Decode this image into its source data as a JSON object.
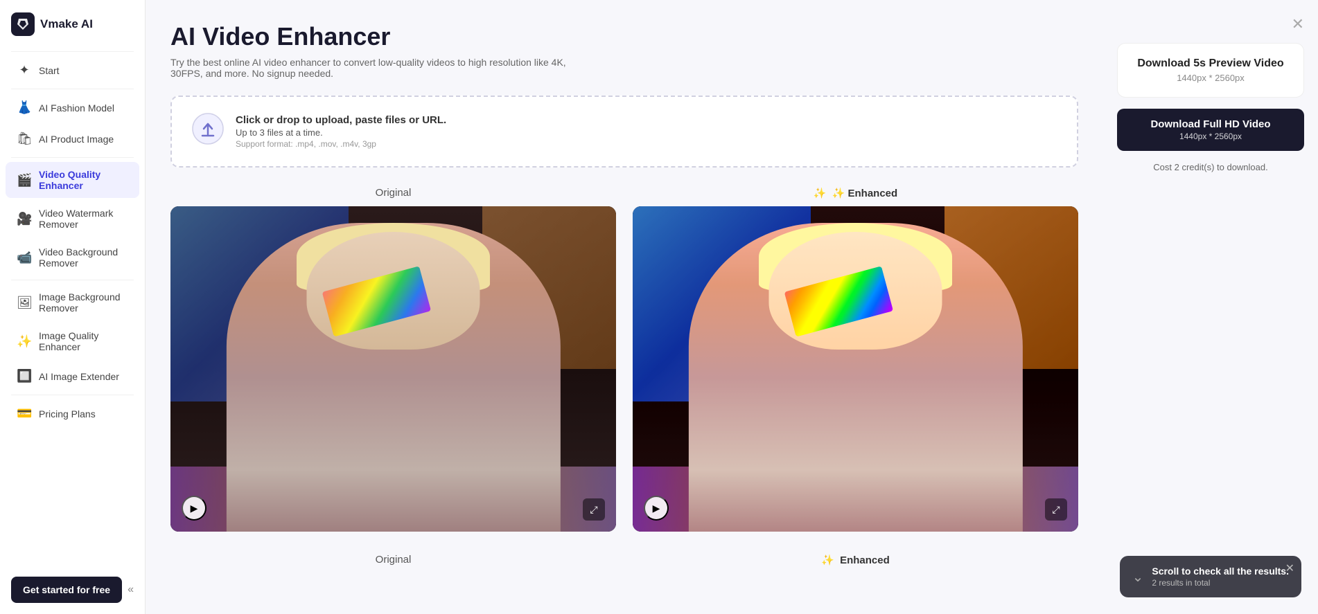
{
  "app": {
    "name": "Vmake AI"
  },
  "sidebar": {
    "logo_icon": "✦",
    "logo_text": "Vmake AI",
    "items": [
      {
        "id": "start",
        "label": "Start",
        "icon": "✦",
        "active": false
      },
      {
        "id": "fashion-model",
        "label": "AI Fashion Model",
        "icon": "👗",
        "active": false
      },
      {
        "id": "product-image",
        "label": "AI Product Image",
        "icon": "🛍",
        "active": false
      },
      {
        "id": "video-quality",
        "label": "Video Quality Enhancer",
        "icon": "🎬",
        "active": true
      },
      {
        "id": "video-watermark",
        "label": "Video Watermark Remover",
        "icon": "🎥",
        "active": false
      },
      {
        "id": "video-bg",
        "label": "Video Background Remover",
        "icon": "📹",
        "active": false
      },
      {
        "id": "image-bg",
        "label": "Image Background Remover",
        "icon": "🖼",
        "active": false
      },
      {
        "id": "image-quality",
        "label": "Image Quality Enhancer",
        "icon": "✨",
        "active": false
      },
      {
        "id": "image-extender",
        "label": "AI Image Extender",
        "icon": "🔲",
        "active": false
      },
      {
        "id": "pricing",
        "label": "Pricing Plans",
        "icon": "💳",
        "active": false
      }
    ],
    "get_started_label": "Get started for free",
    "collapse_icon": "«"
  },
  "page": {
    "title": "AI Video Enhancer",
    "subtitle": "Try the best online AI video enhancer to convert low-quality videos to high resolution like 4K, 30FPS, and more. No signup needed."
  },
  "upload": {
    "main_text": "Click or drop to upload, paste files or URL.",
    "sub_text": "Up to 3 files at a time.",
    "format_text": "Support format: .mp4, .mov, .m4v, 3gp"
  },
  "comparison": {
    "original_label": "Original",
    "enhanced_label": "✨ Enhanced",
    "enhanced_star": "✨"
  },
  "right_panel": {
    "download_preview_title": "Download 5s Preview Video",
    "download_preview_res": "1440px * 2560px",
    "download_full_label": "Download Full HD Video",
    "download_full_res": "1440px * 2560px",
    "credits_text": "Cost 2 credit(s) to download.",
    "close_icon": "✕"
  },
  "toast": {
    "main_text": "Scroll to check all the results.",
    "sub_text": "2 results in total",
    "close_icon": "✕",
    "scroll_icon": "⌄"
  }
}
